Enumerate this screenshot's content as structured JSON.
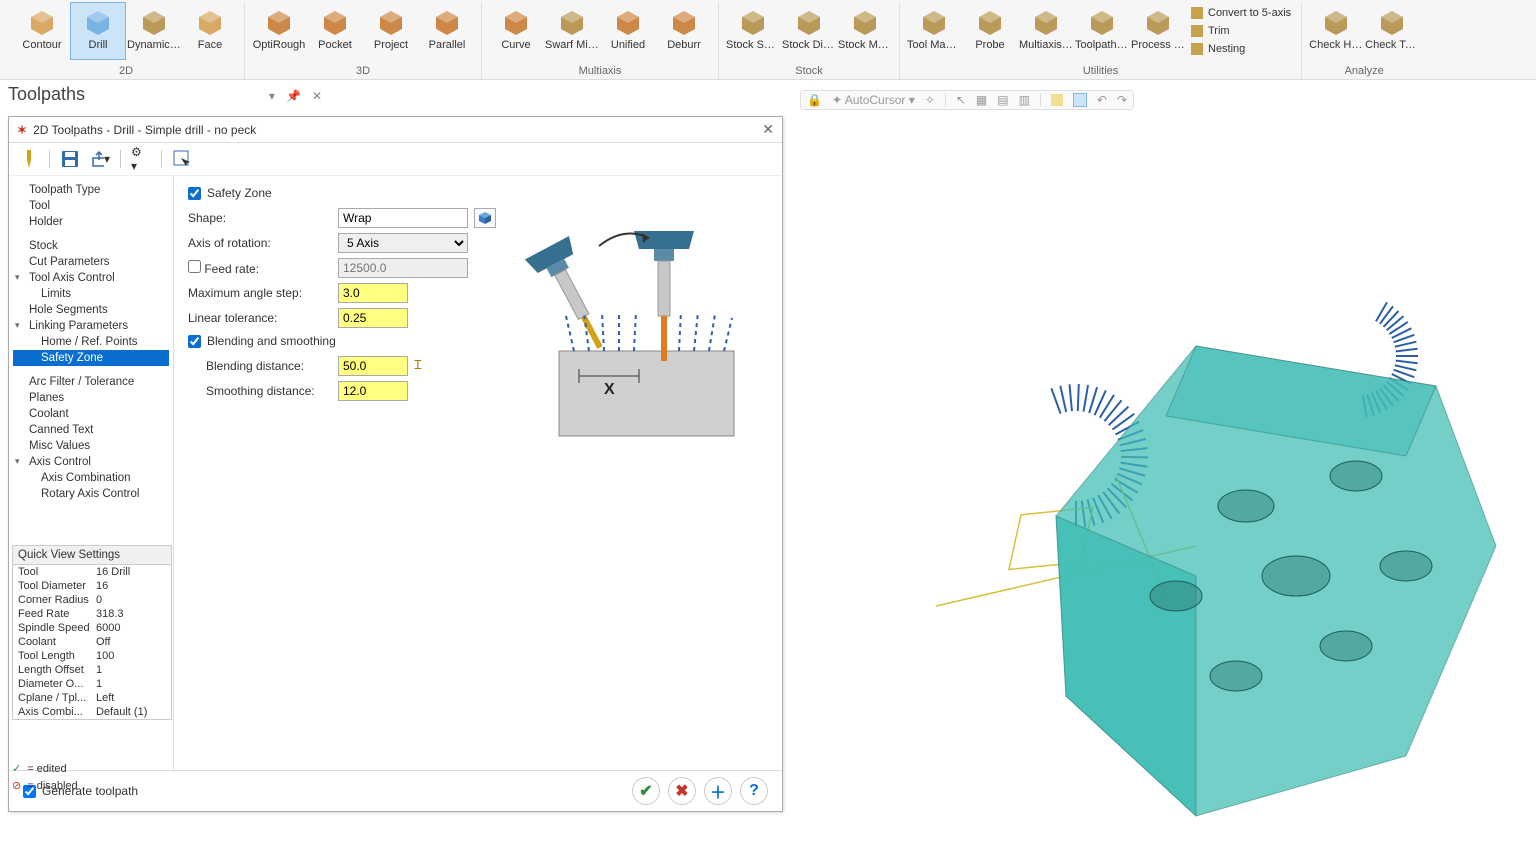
{
  "ribbon": {
    "groups": [
      {
        "label": "2D",
        "items": [
          "Contour",
          "Drill",
          "Dynamic ...",
          "Face"
        ],
        "active": 1
      },
      {
        "label": "3D",
        "items": [
          "OptiRough",
          "Pocket",
          "Project",
          "Parallel"
        ]
      },
      {
        "label": "Multiaxis",
        "items": [
          "Curve",
          "Swarf Milli...",
          "Unified",
          "Deburr"
        ]
      },
      {
        "label": "Stock",
        "items": [
          "Stock Shading",
          "Stock Display",
          "Stock Model ▾"
        ]
      },
      {
        "label": "Utilities",
        "items": [
          "Tool Manager",
          "Probe",
          "Multiaxis Linking",
          "Toolpath Transform",
          "Process Hole"
        ],
        "small": [
          "Convert to 5-axis",
          "Trim",
          "Nesting"
        ]
      },
      {
        "label": "Analyze",
        "items": [
          "Check Holder",
          "Check Tool Reach"
        ]
      }
    ]
  },
  "panel": {
    "title": "Toolpaths"
  },
  "dialog": {
    "title": "2D Toolpaths - Drill - Simple drill - no peck",
    "tree": [
      {
        "l": 1,
        "t": "Toolpath Type"
      },
      {
        "l": 1,
        "t": "Tool"
      },
      {
        "l": 1,
        "t": "Holder"
      },
      {
        "l": 1,
        "t": "Stock",
        "gap": true
      },
      {
        "l": 1,
        "t": "Cut Parameters"
      },
      {
        "l": 1,
        "t": "Tool Axis Control",
        "exp": true
      },
      {
        "l": 2,
        "t": "Limits"
      },
      {
        "l": 1,
        "t": "Hole Segments"
      },
      {
        "l": 1,
        "t": "Linking Parameters",
        "exp": true
      },
      {
        "l": 2,
        "t": "Home / Ref. Points"
      },
      {
        "l": 2,
        "t": "Safety Zone",
        "sel": true
      },
      {
        "l": 1,
        "t": "Arc Filter / Tolerance",
        "gap": true
      },
      {
        "l": 1,
        "t": "Planes"
      },
      {
        "l": 1,
        "t": "Coolant"
      },
      {
        "l": 1,
        "t": "Canned Text"
      },
      {
        "l": 1,
        "t": "Misc Values"
      },
      {
        "l": 1,
        "t": "Axis Control",
        "exp": true
      },
      {
        "l": 2,
        "t": "Axis Combination"
      },
      {
        "l": 2,
        "t": "Rotary Axis Control"
      }
    ],
    "form": {
      "safetyZoneChecked": true,
      "shapeLabel": "Shape:",
      "shapeValue": "Wrap",
      "axisLabel": "Axis of rotation:",
      "axisValue": "5 Axis",
      "feedLabel": "Feed rate:",
      "feedChecked": false,
      "feedValue": "12500.0",
      "maxAngleLabel": "Maximum angle step:",
      "maxAngleValue": "3.0",
      "linTolLabel": "Linear tolerance:",
      "linTolValue": "0.25",
      "blendChecked": true,
      "blendHeader": "Blending and smoothing",
      "blendDistLabel": "Blending distance:",
      "blendDistValue": "50.0",
      "smoothDistLabel": "Smoothing distance:",
      "smoothDistValue": "12.0",
      "safetyHeader": "Safety Zone"
    },
    "footer": {
      "generate": "Generate toolpath"
    }
  },
  "quickview": {
    "title": "Quick View Settings",
    "rows": [
      [
        "Tool",
        "16 Drill"
      ],
      [
        "Tool Diameter",
        "16"
      ],
      [
        "Corner Radius",
        "0"
      ],
      [
        "Feed Rate",
        "318.3"
      ],
      [
        "Spindle Speed",
        "6000"
      ],
      [
        "Coolant",
        "Off"
      ],
      [
        "Tool Length",
        "100"
      ],
      [
        "Length Offset",
        "1"
      ],
      [
        "Diameter O...",
        "1"
      ],
      [
        "Cplane / Tpl...",
        "Left"
      ],
      [
        "Axis Combi...",
        "Default (1)"
      ]
    ]
  },
  "legend": {
    "edited": "= edited",
    "disabled": "= disabled"
  },
  "viewbar": {
    "cursor": "AutoCursor"
  }
}
